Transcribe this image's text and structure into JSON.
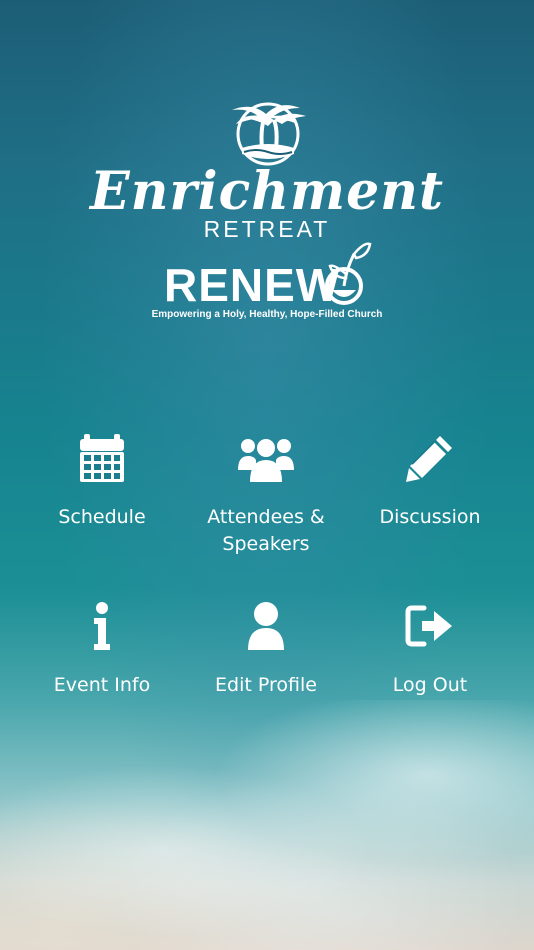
{
  "logo": {
    "script_title": "Enrichment",
    "subtitle": "RETREAT",
    "brand": "RENEW",
    "tagline": "Empowering a Holy, Healthy, Hope-Filled Church"
  },
  "menu": [
    {
      "label": "Schedule",
      "icon": "calendar-icon"
    },
    {
      "label": "Attendees & Speakers",
      "icon": "users-icon"
    },
    {
      "label": "Discussion",
      "icon": "pencil-icon"
    },
    {
      "label": "Event Info",
      "icon": "info-icon"
    },
    {
      "label": "Edit Profile",
      "icon": "user-icon"
    },
    {
      "label": "Log Out",
      "icon": "logout-icon"
    }
  ],
  "colors": {
    "text": "#ffffff",
    "ocean_top": "#1c5e76",
    "ocean_mid": "#16838f",
    "sand": "#ddd6cd"
  }
}
